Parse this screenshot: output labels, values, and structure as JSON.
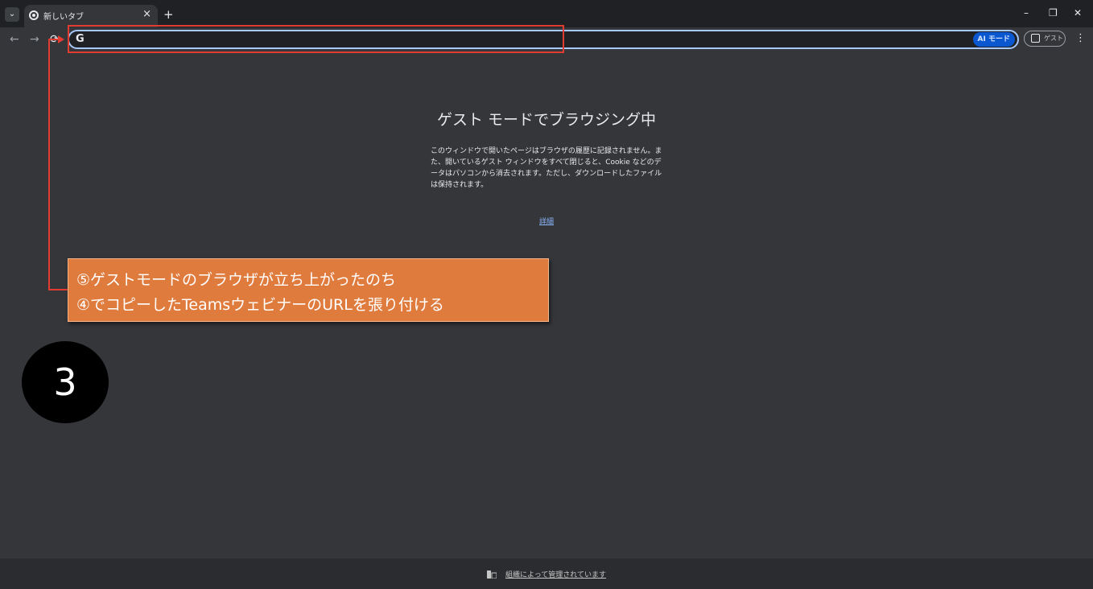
{
  "tab": {
    "title": "新しいタブ",
    "close": "×"
  },
  "tabstrip": {
    "search_icon": "⌄",
    "new_tab": "+"
  },
  "window": {
    "minimize": "–",
    "restore": "❐",
    "close": "✕"
  },
  "toolbar": {
    "back": "←",
    "forward": "→",
    "reload": "⟳",
    "omnibox_icon": "G",
    "omnibox_value": "",
    "ai_mode_label": "AI モード",
    "profile_label": "ゲスト",
    "menu": "⋮"
  },
  "main": {
    "title": "ゲスト モードでブラウジング中",
    "description": "このウィンドウで開いたページはブラウザの履歴に記録されません。また、開いているゲスト ウィンドウをすべて閉じると、Cookie などのデータはパソコンから消去されます。ただし、ダウンロードしたファイルは保持されます。",
    "learn_more": "詳細"
  },
  "callout": {
    "line1": "⑤ゲストモードのブラウザが立ち上がったのち",
    "line2": "④でコピーしたTeamsウェビナーのURLを張り付ける"
  },
  "step": {
    "number": "3"
  },
  "footer": {
    "managed_text": "組織によって管理されています"
  },
  "colors": {
    "annotation": "#e03c31",
    "callout_bg": "#e07b3e",
    "omnibox_border": "#a8c7fa",
    "link": "#8ab4f8"
  },
  "icons": [
    "tab-search-icon",
    "chrome-favicon",
    "close-icon",
    "plus-icon",
    "back-arrow-icon",
    "forward-arrow-icon",
    "reload-icon",
    "google-g-icon",
    "ai-mode-icon",
    "profile-icon",
    "menu-icon",
    "building-icon"
  ]
}
